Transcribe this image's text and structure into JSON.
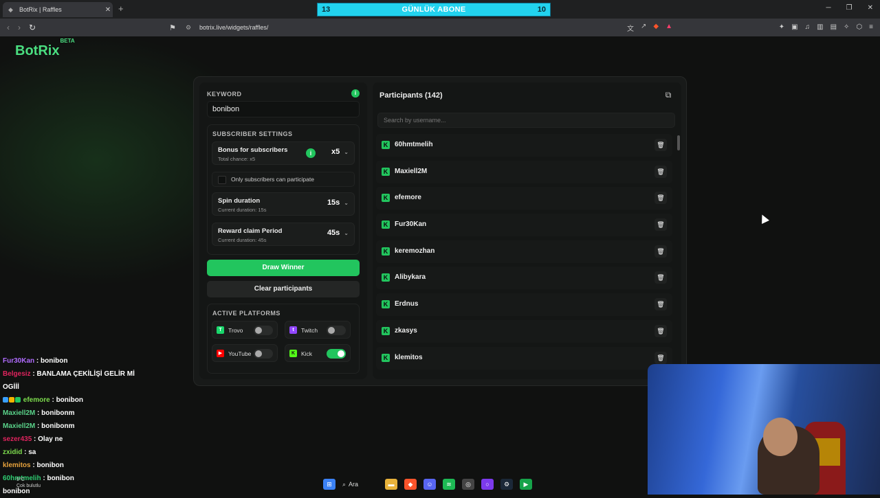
{
  "browser": {
    "tab_title": "BotRix | Raffles",
    "url": "botrix.live/widgets/raffles/",
    "new_tab_label": "+",
    "close_label": "✕"
  },
  "subscriber_goal": {
    "left": "13",
    "title": "GÜNLÜK ABONE",
    "right": "10"
  },
  "app": {
    "logo": "BotRix",
    "logo_badge": "BETA"
  },
  "raffle": {
    "keyword_label": "KEYWORD",
    "keyword_value": "bonibon",
    "subscriber_settings_title": "SUBSCRIBER SETTINGS",
    "bonus": {
      "title": "Bonus for subscribers",
      "subtitle": "Total chance: x5",
      "value": "x5"
    },
    "only_subs_label": "Only subscribers can participate",
    "spin": {
      "title": "Spin duration",
      "subtitle": "Current duration: 15s",
      "value": "15s"
    },
    "reward": {
      "title": "Reward claim Period",
      "subtitle": "Current duration: 45s",
      "value": "45s"
    },
    "draw_button": "Draw Winner",
    "clear_button": "Clear participants",
    "platforms_title": "ACTIVE PLATFORMS",
    "platforms": [
      {
        "name": "Trovo",
        "enabled": false,
        "color": "#19d66b"
      },
      {
        "name": "Twitch",
        "enabled": false,
        "color": "#9146ff"
      },
      {
        "name": "YouTube",
        "enabled": false,
        "color": "#ff0000"
      },
      {
        "name": "Kick",
        "enabled": true,
        "color": "#53fc18"
      }
    ]
  },
  "participants": {
    "title": "Participants (142)",
    "search_placeholder": "Search by username...",
    "list": [
      "60hmtmelih",
      "Maxiell2M",
      "efemore",
      "Fur30Kan",
      "keremozhan",
      "Alibykara",
      "Erdnus",
      "zkasys",
      "klemitos"
    ]
  },
  "chat": [
    {
      "user": "Fur30Kan",
      "text": " : bonibon",
      "color": "#b06cff"
    },
    {
      "user": "Belgesiz",
      "text": " : BANLAMA ÇEKİLİŞİ GELİR Mİ",
      "color": "#e0245e"
    },
    {
      "user": "",
      "text": "OGİİİ",
      "color": "#ffffff"
    },
    {
      "user": "efemore",
      "text": " : bonibon",
      "color": "#7ddc4d"
    },
    {
      "user": "Maxiell2M",
      "text": " : bonibonm",
      "color": "#5ad38a"
    },
    {
      "user": "Maxiell2M",
      "text": " : bonibonm",
      "color": "#5ad38a"
    },
    {
      "user": "sezer435",
      "text": " : Olay ne",
      "color": "#e0245e"
    },
    {
      "user": "zxidid",
      "text": " : sa",
      "color": "#7ddc4d"
    },
    {
      "user": "klemitos",
      "text": " : bonibon",
      "color": "#e8a33d"
    },
    {
      "user": "60hmtmelih",
      "text": " : bonibon",
      "color": "#2ecc71"
    },
    {
      "user": "",
      "text": "bonibon",
      "color": "#ffffff"
    }
  ],
  "weather": {
    "temp": "9°C",
    "desc": "Çok bulutlu"
  },
  "taskbar": {
    "search_label": "Ara"
  },
  "colors": {
    "accent": "#22c55e",
    "goal_bar": "#22d3ee"
  }
}
